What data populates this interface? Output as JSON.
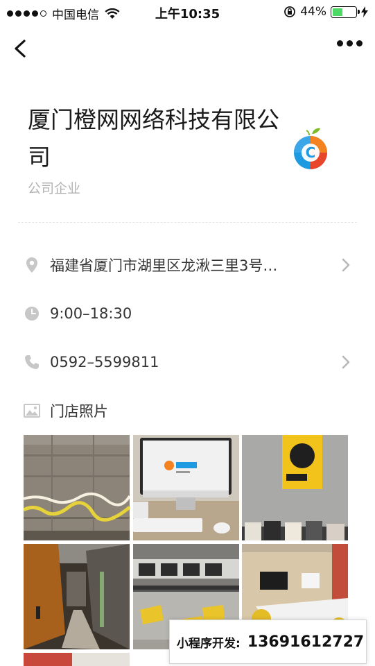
{
  "status_bar": {
    "carrier": "中国电信",
    "time": "上午10:35",
    "battery": "44%",
    "battery_level": 0.44
  },
  "nav": {
    "back_icon": "back-chevron-icon",
    "more_icon": "more-dots-icon"
  },
  "header": {
    "title": "厦门橙网网络科技有限公司",
    "category": "公司企业",
    "logo_letter": "C",
    "logo_colors": [
      "#f58220",
      "#1e9be0",
      "#7dbb2b"
    ]
  },
  "info": {
    "address": "福建省厦门市湖里区龙湫三里3号…",
    "hours": "9:00–18:30",
    "phone": "0592–5599811",
    "photos_label": "门店照片"
  },
  "photos": [
    {
      "alt": "wood-wall-photo"
    },
    {
      "alt": "imac-desk-photo"
    },
    {
      "alt": "poster-wall-photo"
    },
    {
      "alt": "corridor-photo"
    },
    {
      "alt": "lounge-photo"
    },
    {
      "alt": "meeting-room-photo"
    },
    {
      "alt": "red-photo"
    }
  ],
  "dev_banner": {
    "label": "小程序开发:",
    "phone": "13691612727"
  }
}
